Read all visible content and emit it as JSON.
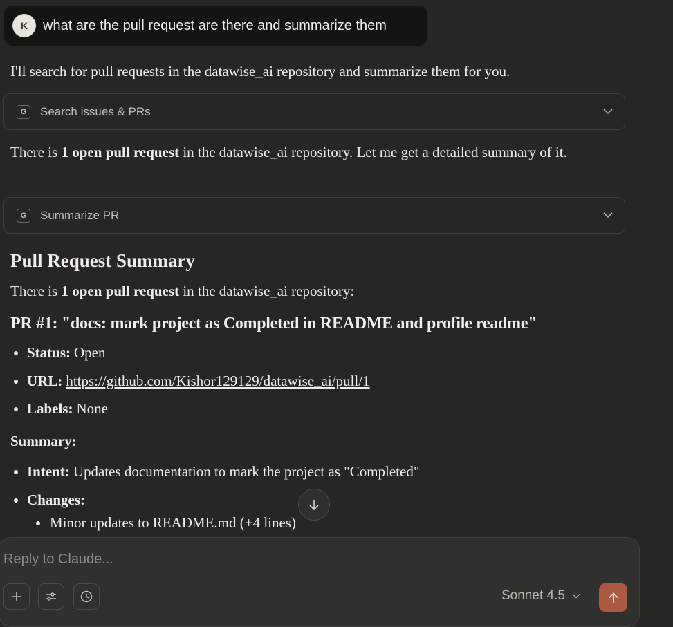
{
  "user_message": {
    "avatar_initial": "K",
    "text": "what are the pull request are there and summarize them"
  },
  "assistant": {
    "intro": "I'll search for pull requests in the datawise_ai repository and summarize them for you.",
    "tool_1": {
      "icon": "G",
      "label": "Search issues & PRs"
    },
    "para_2": {
      "pre": "There is ",
      "bold": "1 open pull request",
      "post": " in the datawise_ai repository. Let me get a detailed summary of it."
    },
    "tool_2": {
      "icon": "G",
      "label": "Summarize PR"
    },
    "heading": "Pull Request Summary",
    "para_3": {
      "pre": "There is ",
      "bold": "1 open pull request",
      "post": " in the datawise_ai repository:"
    },
    "pr_title": "PR #1: \"docs: mark project as Completed in README and profile readme\"",
    "status": {
      "label": "Status:",
      "value": "Open"
    },
    "url": {
      "label": "URL:",
      "value": "https://github.com/Kishor129129/datawise_ai/pull/1"
    },
    "labels": {
      "label": "Labels:",
      "value": "None"
    },
    "summary_label": "Summary:",
    "intent": {
      "label": "Intent:",
      "value": "Updates documentation to mark the project as \"Completed\""
    },
    "changes": {
      "label": "Changes:"
    },
    "changes_items": [
      "Minor updates to README.md (+4 lines)"
    ]
  },
  "composer": {
    "placeholder": "Reply to Claude...",
    "model": "Sonnet 4.5"
  },
  "colors": {
    "background": "#262624",
    "user_bubble": "#141413",
    "composer": "#30302e",
    "send_button": "#ab5a43",
    "text": "#f0eee6"
  }
}
